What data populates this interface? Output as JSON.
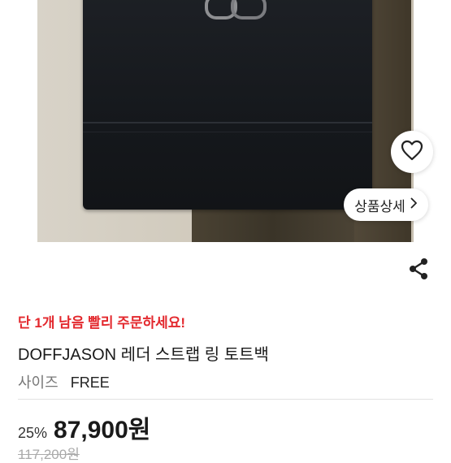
{
  "product": {
    "urgency_text": "단 1개 남음 빨리 주문하세요!",
    "title": "DOFFJASON 레더 스트랩 링 토트백",
    "size_label": "사이즈",
    "size_value": "FREE",
    "discount": "25%",
    "price": "87,900원",
    "original_price": "117,200원"
  },
  "actions": {
    "detail_label": "상품상세",
    "detail_icon": "chevron-right-icon",
    "wishlist_icon": "heart-icon",
    "share_icon": "share-icon"
  },
  "colors": {
    "urgency": "#e3282d",
    "text": "#1a1a1a",
    "muted": "#777777"
  }
}
